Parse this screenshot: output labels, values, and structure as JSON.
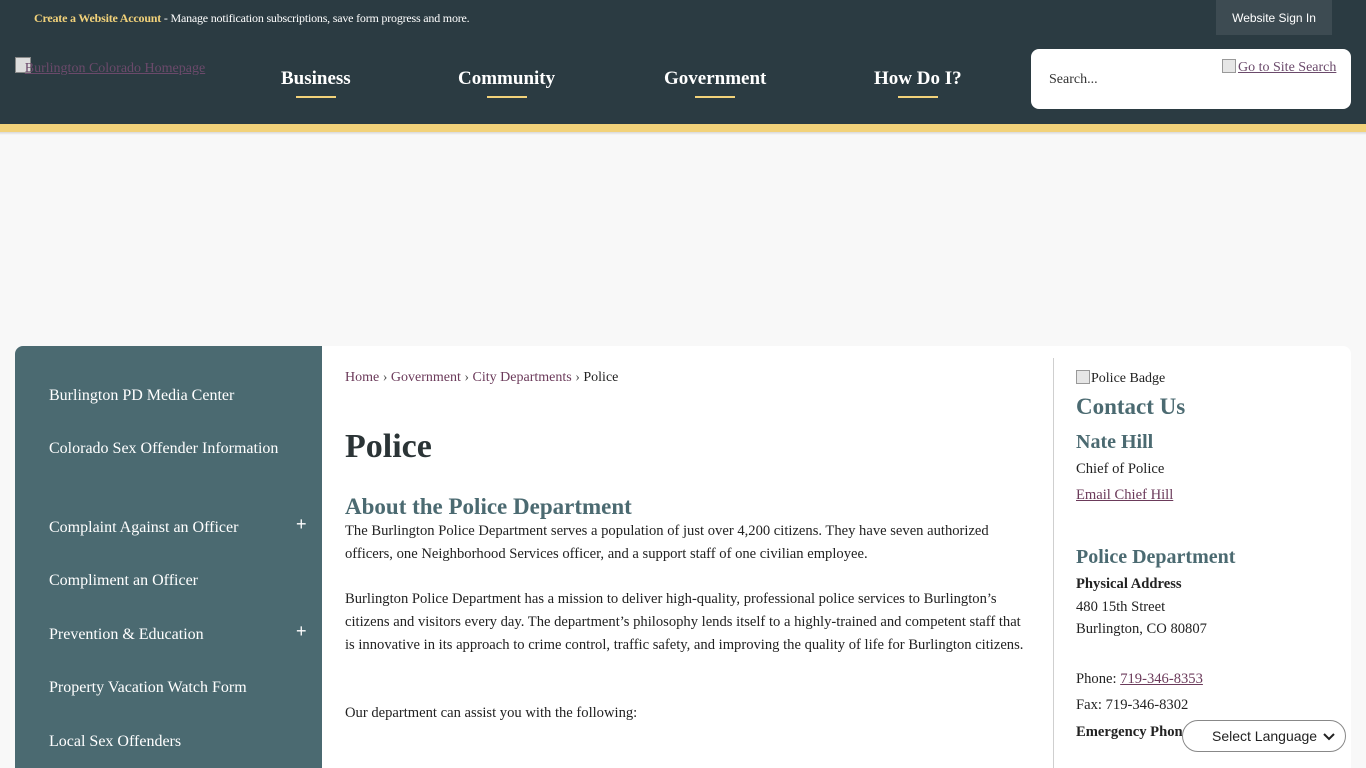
{
  "topbar": {
    "create_link": "Create a Website Account",
    "create_desc": " - Manage notification subscriptions, save form progress and more.",
    "signin_label": "Website Sign In"
  },
  "header": {
    "logo_alt": "Burlington Colorado Homepage",
    "nav": [
      "Business",
      "Community",
      "Government",
      "How Do I?"
    ],
    "search_placeholder": "Search...",
    "search_go_alt": "Go to Site Search"
  },
  "sidebar": {
    "items": [
      {
        "label": "Burlington PD Media Center",
        "expand": ""
      },
      {
        "label": "Colorado Sex Offender Information",
        "expand": ""
      },
      {
        "label": "Complaint Against an Officer",
        "expand": "+"
      },
      {
        "label": "Compliment an Officer",
        "expand": ""
      },
      {
        "label": "Prevention & Education",
        "expand": "+"
      },
      {
        "label": "Property Vacation Watch Form",
        "expand": ""
      },
      {
        "label": "Local Sex Offenders",
        "expand": ""
      }
    ]
  },
  "breadcrumb": {
    "items": [
      "Home",
      "Government",
      "City Departments"
    ],
    "separator": "›",
    "current": "Police"
  },
  "main": {
    "title": "Police",
    "section_title": "About the Police Department",
    "paragraphs": [
      "The Burlington Police Department serves a population of just over 4,200 citizens. They have seven authorized officers, one Neighborhood Services officer, and a support staff of one civilian employee.",
      "Burlington Police Department has a mission to deliver high-quality, professional police services to Burlington’s citizens and visitors every day. The department’s philosophy lends itself to a highly-trained and competent staff that is innovative in its approach to crime control, traffic safety, and improving the quality of life for Burlington citizens.",
      "Our department can assist you with the following:"
    ]
  },
  "contact": {
    "badge_alt": "Police Badge",
    "heading": "Contact Us",
    "name": "Nate Hill",
    "role": "Chief of Police",
    "email_label": "Email Chief Hill",
    "dept_heading": "Police Department",
    "address_label": "Physical Address",
    "address_line1": "480 15th Street",
    "address_line2": "Burlington, CO 80807",
    "phone_label": "Phone: ",
    "phone": "719-346-8353",
    "fax_label": "Fax: ",
    "fax": "719-346-8302",
    "emergency_label": "Emergency Phone"
  },
  "language": {
    "label": "Select Language"
  },
  "colors": {
    "header_bg": "#2b3b42",
    "accent_gold": "#f2d27a",
    "sidebar_bg": "#4b6a71",
    "link": "#6b3a5a"
  }
}
